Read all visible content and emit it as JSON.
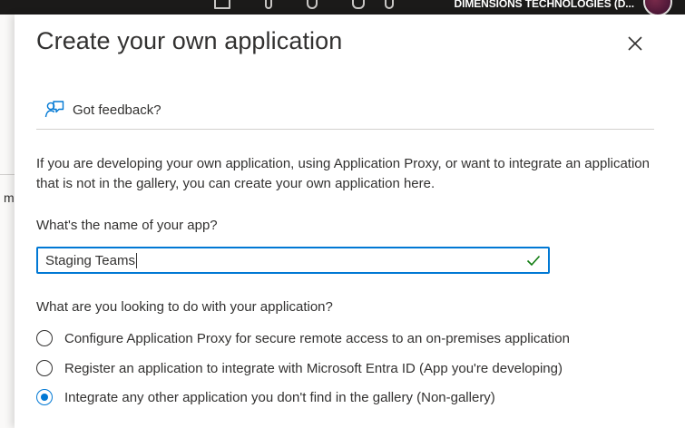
{
  "header": {
    "tenant_name": "DIMENSIONS TECHNOLOGIES (D..."
  },
  "background": {
    "partial_text": "m"
  },
  "panel": {
    "title": "Create your own application",
    "feedback_label": "Got feedback?",
    "description": "If you are developing your own application, using Application Proxy, or want to integrate an application that is not in the gallery, you can create your own application here.",
    "name_label": "What's the name of your app?",
    "name_value": "Staging Teams",
    "name_valid": true,
    "purpose_label": "What are you looking to do with your application?",
    "options": [
      {
        "label": "Configure Application Proxy for secure remote access to an on-premises application",
        "selected": false
      },
      {
        "label": "Register an application to integrate with Microsoft Entra ID (App you're developing)",
        "selected": false
      },
      {
        "label": "Integrate any other application you don't find in the gallery (Non-gallery)",
        "selected": true
      }
    ]
  },
  "colors": {
    "accent": "#0078d4",
    "valid": "#107c10",
    "topbar": "#1b1a19"
  },
  "icons": [
    "close-icon",
    "feedback-icon",
    "checkmark-icon"
  ]
}
